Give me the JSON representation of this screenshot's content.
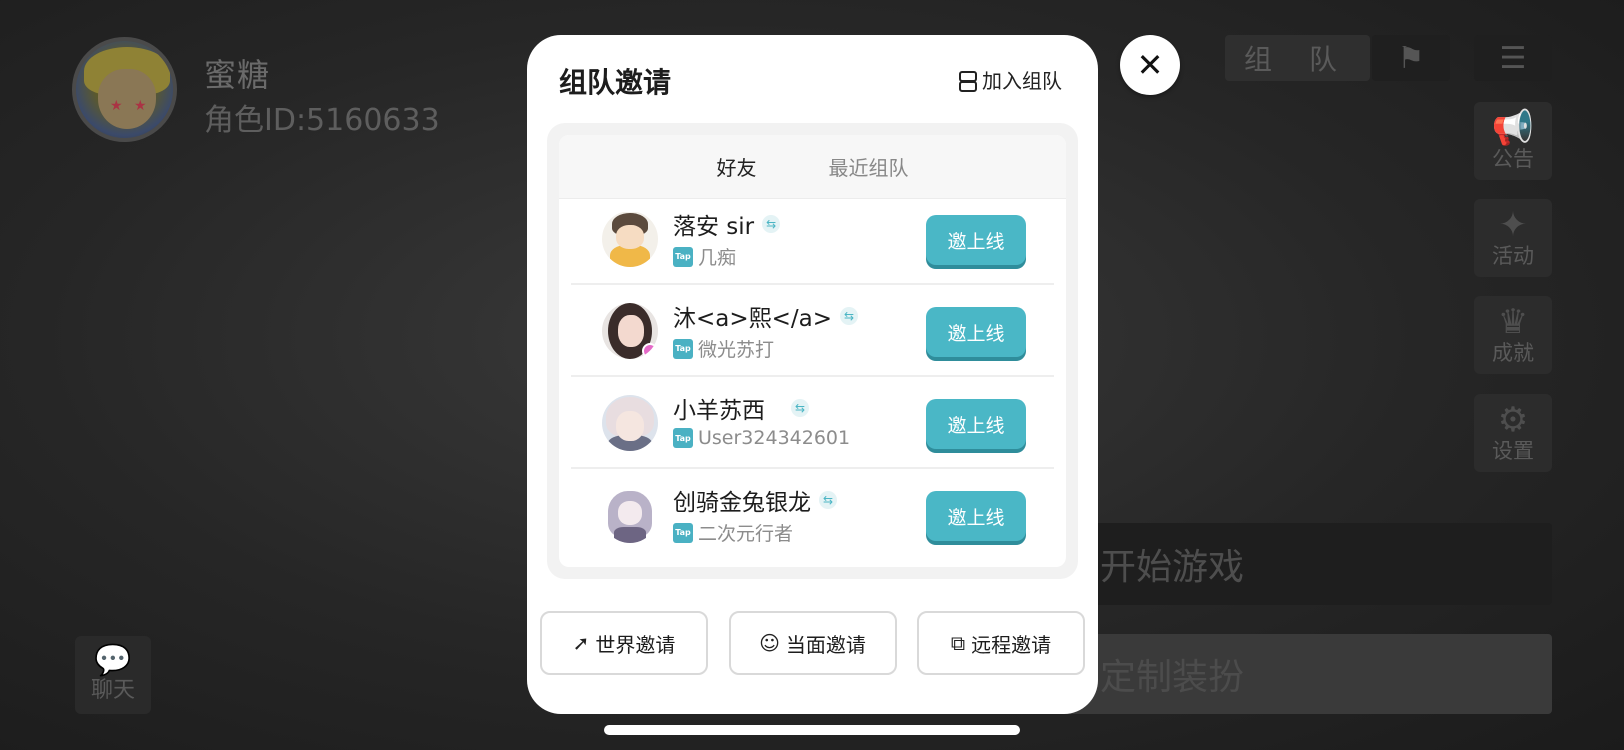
{
  "player": {
    "name": "蜜糖",
    "id_label": "角色ID:5160633"
  },
  "top_bar": {
    "team_label": "组 队"
  },
  "side_menu": [
    {
      "label": "公告",
      "icon": "megaphone-icon"
    },
    {
      "label": "活动",
      "icon": "party-popper-icon"
    },
    {
      "label": "成就",
      "icon": "trophy-icon"
    },
    {
      "label": "设置",
      "icon": "gear-icon"
    }
  ],
  "main_buttons": {
    "start": "开始游戏",
    "customize": "定制装扮"
  },
  "chat": {
    "label": "聊天"
  },
  "modal": {
    "title": "组队邀请",
    "join_team_label": "加入组队",
    "tabs": [
      {
        "label": "好友",
        "active": true
      },
      {
        "label": "最近组队",
        "active": false
      }
    ],
    "friends": [
      {
        "name": "落安 sir",
        "sub": "几痴",
        "action": "邀上线"
      },
      {
        "name": "沐<a>熙</a>",
        "sub": "微光苏打",
        "action": "邀上线"
      },
      {
        "name": "小羊苏西",
        "sub": "User324342601",
        "action": "邀上线"
      },
      {
        "name": "创骑金兔银龙",
        "sub": "二次元行者",
        "action": "邀上线"
      }
    ],
    "bottom_buttons": [
      {
        "label": "世界邀请",
        "icon": "send-icon"
      },
      {
        "label": "当面邀请",
        "icon": "face-icon"
      },
      {
        "label": "远程邀请",
        "icon": "external-link-icon"
      }
    ],
    "tap_badge": "Tap"
  },
  "colors": {
    "accent": "#4ab7c6",
    "modal_bg": "#ffffff"
  }
}
